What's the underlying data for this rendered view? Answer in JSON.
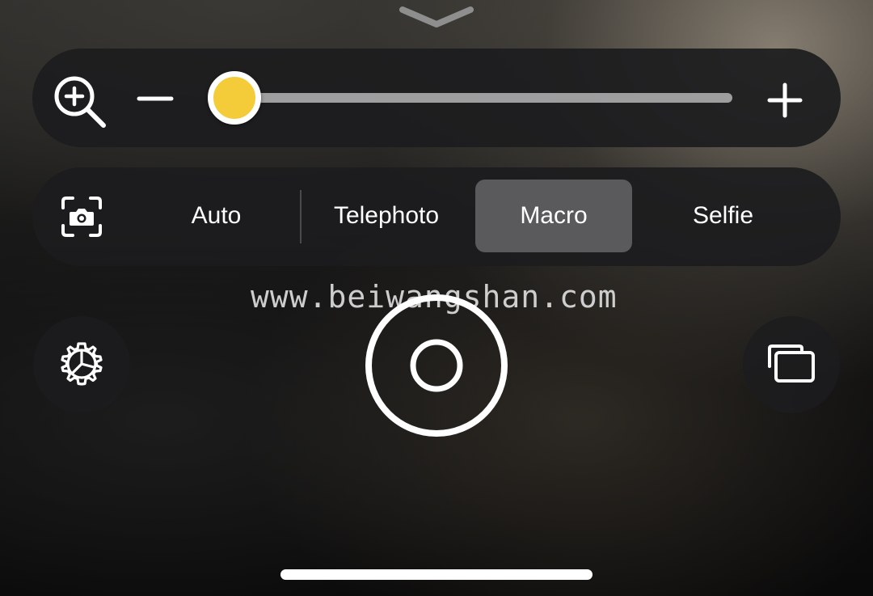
{
  "top": {
    "collapse_icon": "chevron-down-icon"
  },
  "zoom": {
    "icon": "zoom-in-icon",
    "decrease_icon": "minus-icon",
    "increase_icon": "plus-icon",
    "level": 0
  },
  "modes": {
    "camera_icon": "camera-frame-icon",
    "items": [
      {
        "label": "Auto",
        "selected": false
      },
      {
        "label": "Telephoto",
        "selected": false
      },
      {
        "label": "Macro",
        "selected": true
      },
      {
        "label": "Selfie",
        "selected": false
      }
    ]
  },
  "watermark": {
    "text": "www.beiwangshan.com"
  },
  "controls": {
    "settings_icon": "gear-icon",
    "shutter_icon": "shutter-icon",
    "gallery_icon": "gallery-icon"
  },
  "colors": {
    "accent": "#f4cc3a",
    "panel": "#1c1c1e",
    "selected_tab": "#5a5a5c",
    "text": "#ffffff"
  }
}
